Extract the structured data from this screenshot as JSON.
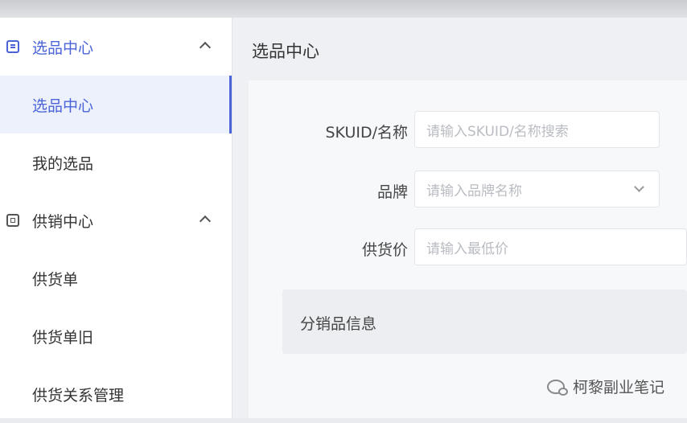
{
  "sidebar": {
    "groups": [
      {
        "label": "选品中心",
        "icon": "list-icon",
        "items": [
          {
            "label": "选品中心",
            "active": true
          },
          {
            "label": "我的选品",
            "active": false
          }
        ]
      },
      {
        "label": "供销中心",
        "icon": "supply-icon",
        "items": [
          {
            "label": "供货单",
            "active": false
          },
          {
            "label": "供货单旧",
            "active": false
          },
          {
            "label": "供货关系管理",
            "active": false
          }
        ]
      }
    ]
  },
  "main": {
    "title": "选品中心",
    "form": {
      "sku": {
        "label": "SKUID/名称",
        "placeholder": "请输入SKUID/名称搜索"
      },
      "brand": {
        "label": "品牌",
        "placeholder": "请输入品牌名称"
      },
      "price": {
        "label": "供货价",
        "placeholder": "请输入最低价"
      }
    },
    "section_title": "分销品信息"
  },
  "watermark": {
    "text": "柯黎副业笔记",
    "icon": "wechat-icon"
  },
  "colors": {
    "accent": "#4a63d8",
    "active_bg": "#edf1fb",
    "page_bg": "#eef0f3"
  }
}
